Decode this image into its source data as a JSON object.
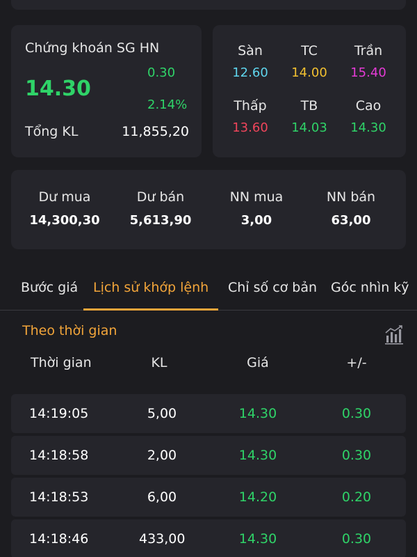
{
  "colors": {
    "up": "#2fd368",
    "floor": "#5fd6ee",
    "reference": "#f2c030",
    "ceiling": "#e53bd6",
    "low": "#f0455b",
    "accent": "#f2a53a",
    "card": "#25252b",
    "background": "#1c1c20"
  },
  "stock": {
    "name": "Chứng khoán SG HN",
    "price": "14.30",
    "change": "0.30",
    "change_pct": "2.14%",
    "volume_label": "Tổng KL",
    "volume_value": "11,855,20"
  },
  "ref": {
    "floor": {
      "label": "Sàn",
      "value": "12.60"
    },
    "reference": {
      "label": "TC",
      "value": "14.00"
    },
    "ceiling": {
      "label": "Trần",
      "value": "15.40"
    },
    "low": {
      "label": "Thấp",
      "value": "13.60"
    },
    "average": {
      "label": "TB",
      "value": "14.03"
    },
    "high": {
      "label": "Cao",
      "value": "14.30"
    }
  },
  "depth": {
    "buy_remain": {
      "label": "Dư mua",
      "value": "14,300,30"
    },
    "sell_remain": {
      "label": "Dư bán",
      "value": "5,613,90"
    },
    "foreign_buy": {
      "label": "NN mua",
      "value": "3,00"
    },
    "foreign_sell": {
      "label": "NN bán",
      "value": "63,00"
    }
  },
  "tabs": [
    "Bước giá",
    "Lịch sử khớp lệnh",
    "Chỉ số cơ bản",
    "Góc nhìn kỹ"
  ],
  "active_tab": 1,
  "history": {
    "title": "Theo thời gian",
    "chart_icon": "bar-chart-icon",
    "columns": [
      "Thời gian",
      "KL",
      "Giá",
      "+/-"
    ],
    "rows": [
      {
        "time": "14:19:05",
        "volume": "5,00",
        "price": "14.30",
        "change": "0.30"
      },
      {
        "time": "14:18:58",
        "volume": "2,00",
        "price": "14.30",
        "change": "0.30"
      },
      {
        "time": "14:18:53",
        "volume": "6,00",
        "price": "14.20",
        "change": "0.20"
      },
      {
        "time": "14:18:46",
        "volume": "433,00",
        "price": "14.30",
        "change": "0.30"
      }
    ]
  }
}
